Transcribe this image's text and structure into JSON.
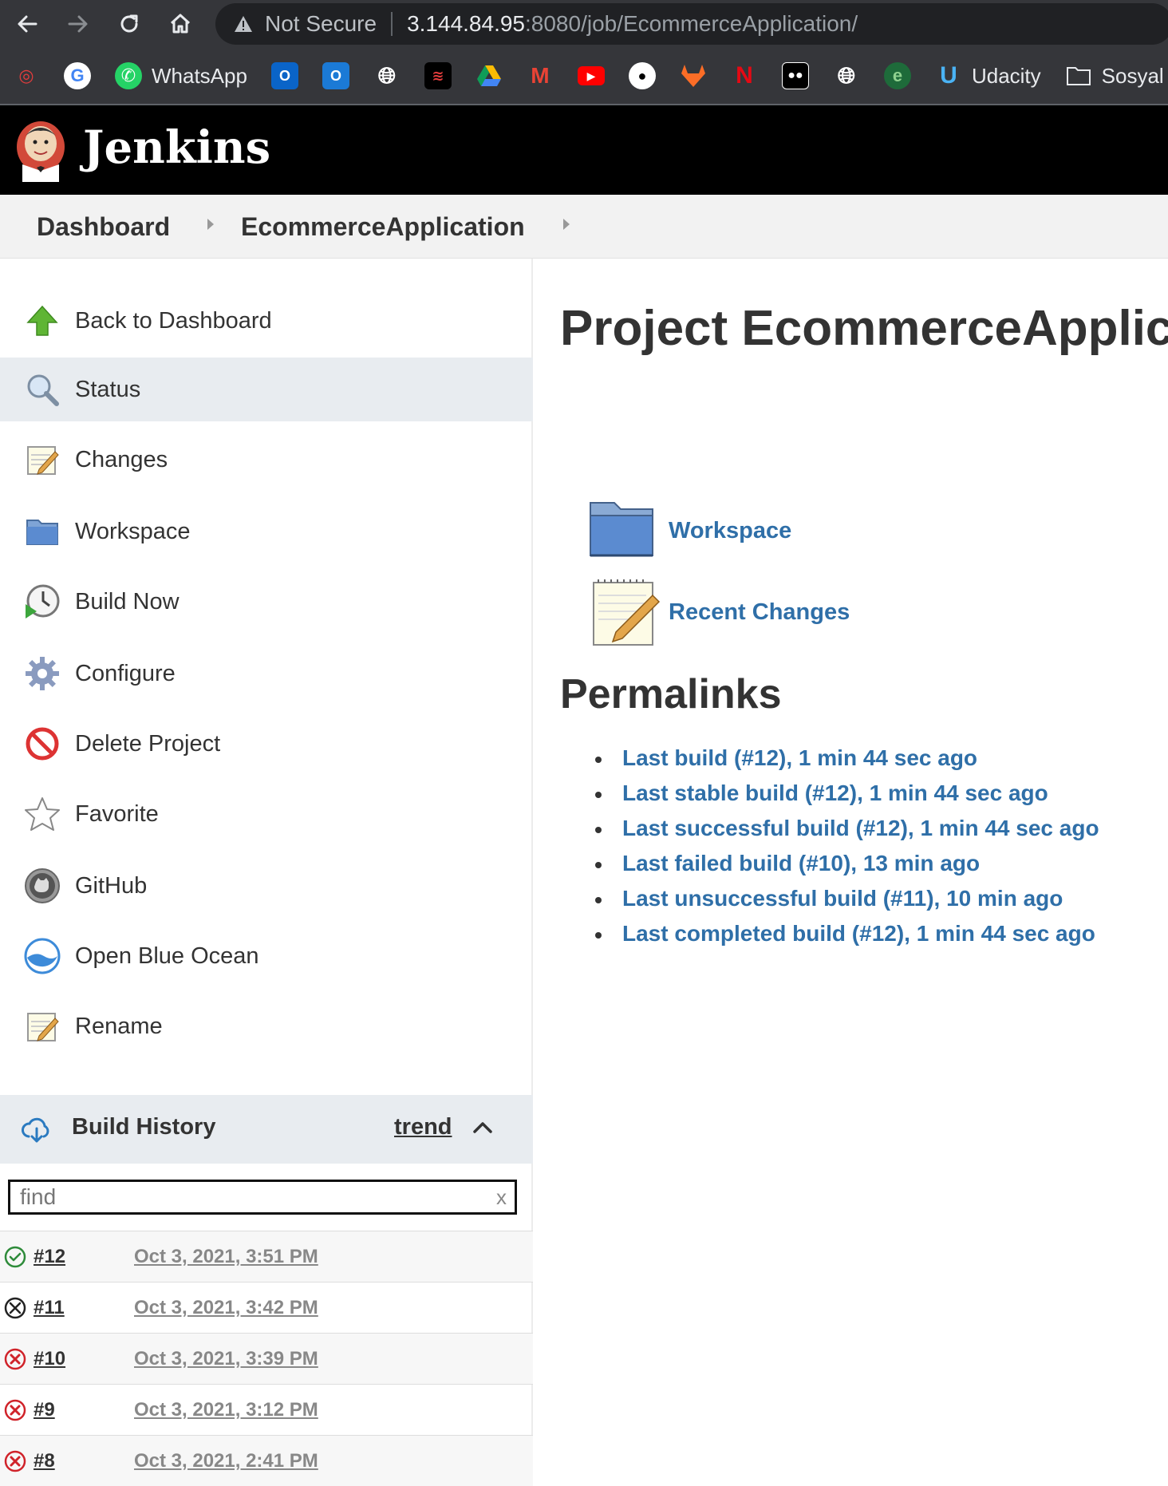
{
  "browser": {
    "url_warning": "Not Secure",
    "url_host": "3.144.84.95",
    "url_path": ":8080/job/EcommerceApplication/",
    "bookmarks": [
      {
        "icon": "app-icon",
        "label": ""
      },
      {
        "icon": "google-icon",
        "label": ""
      },
      {
        "icon": "whatsapp-icon",
        "label": "WhatsApp"
      },
      {
        "icon": "outlook-icon",
        "label": ""
      },
      {
        "icon": "outlook-icon",
        "label": ""
      },
      {
        "icon": "globe-icon",
        "label": ""
      },
      {
        "icon": "app-icon",
        "label": ""
      },
      {
        "icon": "google-drive-icon",
        "label": ""
      },
      {
        "icon": "gmail-icon",
        "label": ""
      },
      {
        "icon": "youtube-icon",
        "label": ""
      },
      {
        "icon": "github-icon",
        "label": ""
      },
      {
        "icon": "gitlab-icon",
        "label": ""
      },
      {
        "icon": "netflix-icon",
        "label": ""
      },
      {
        "icon": "medium-icon",
        "label": ""
      },
      {
        "icon": "globe-icon",
        "label": ""
      },
      {
        "icon": "app-icon",
        "label": ""
      },
      {
        "icon": "udacity-icon",
        "label": "Udacity"
      },
      {
        "icon": "folder-icon",
        "label": "Sosyal"
      }
    ]
  },
  "header": {
    "title": "Jenkins"
  },
  "breadcrumb": {
    "items": [
      "Dashboard",
      "EcommerceApplication"
    ]
  },
  "sidebar": {
    "tasks": [
      {
        "label": "Back to Dashboard",
        "icon": "up-arrow-icon"
      },
      {
        "label": "Status",
        "icon": "search-icon"
      },
      {
        "label": "Changes",
        "icon": "notepad-icon"
      },
      {
        "label": "Workspace",
        "icon": "folder-icon"
      },
      {
        "label": "Build Now",
        "icon": "clock-icon"
      },
      {
        "label": "Configure",
        "icon": "gear-icon"
      },
      {
        "label": "Delete Project",
        "icon": "no-entry-icon"
      },
      {
        "label": "Favorite",
        "icon": "star-icon"
      },
      {
        "label": "GitHub",
        "icon": "github-icon"
      },
      {
        "label": "Open Blue Ocean",
        "icon": "blue-ocean-icon"
      },
      {
        "label": "Rename",
        "icon": "notepad-icon"
      }
    ],
    "active_task": "Status"
  },
  "build_history": {
    "title": "Build History",
    "trend_label": "trend",
    "find_placeholder": "find",
    "clear_label": "x",
    "builds": [
      {
        "number": "#12",
        "date": "Oct 3, 2021, 3:51 PM",
        "status": "success"
      },
      {
        "number": "#11",
        "date": "Oct 3, 2021, 3:42 PM",
        "status": "aborted"
      },
      {
        "number": "#10",
        "date": "Oct 3, 2021, 3:39 PM",
        "status": "failed"
      },
      {
        "number": "#9",
        "date": "Oct 3, 2021, 3:12 PM",
        "status": "failed"
      },
      {
        "number": "#8",
        "date": "Oct 3, 2021, 2:41 PM",
        "status": "failed"
      }
    ]
  },
  "main": {
    "title": "Project EcommerceApplication",
    "links": [
      {
        "label": "Workspace",
        "icon": "folder-icon"
      },
      {
        "label": "Recent Changes",
        "icon": "notepad-icon"
      }
    ],
    "permalinks_title": "Permalinks",
    "permalinks": [
      "Last build (#12), 1 min 44 sec ago",
      "Last stable build (#12), 1 min 44 sec ago",
      "Last successful build (#12), 1 min 44 sec ago",
      "Last failed build (#10), 13 min ago",
      "Last unsuccessful build (#11), 10 min ago",
      "Last completed build (#12), 1 min 44 sec ago"
    ]
  },
  "colors": {
    "link": "#2f6fa8",
    "header_bg": "#000000",
    "success": "#2e8b3a",
    "failed": "#d0232a"
  }
}
